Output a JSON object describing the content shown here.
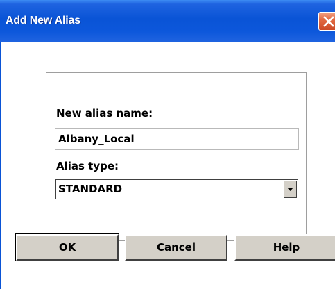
{
  "window": {
    "title": "Add New Alias"
  },
  "form": {
    "alias_name_label": "New alias name:",
    "alias_name_value": "Albany_Local",
    "alias_type_label": "Alias type:",
    "alias_type_value": "STANDARD"
  },
  "buttons": {
    "ok": "OK",
    "cancel": "Cancel",
    "help": "Help"
  },
  "icons": {
    "close": "close-icon",
    "dropdown": "chevron-down-icon"
  },
  "colors": {
    "titlebar": "#0a54d6",
    "close_button": "#e26a43",
    "button_face": "#d4d0c8"
  }
}
